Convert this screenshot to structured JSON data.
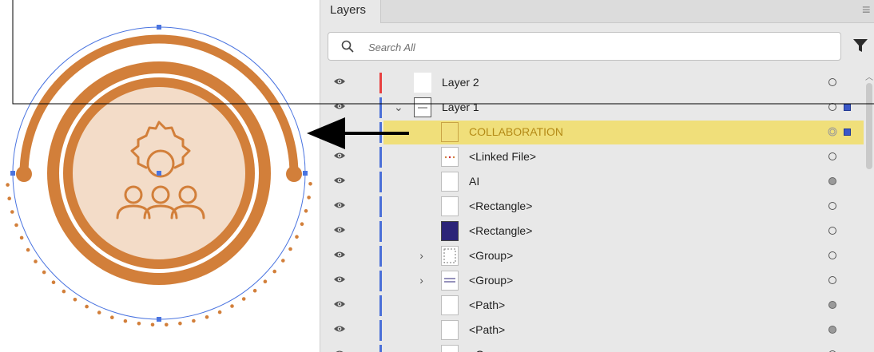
{
  "panel": {
    "tab_label": "Layers",
    "menu_icon": "hamburger-menu-icon",
    "search": {
      "placeholder": "Search All",
      "value": ""
    },
    "filter_icon": "filter-funnel-icon"
  },
  "layers": [
    {
      "label": "Layer 2",
      "bar_color": "#e84040",
      "thumb": "t-layer2",
      "chevron": "",
      "indent": 0,
      "target": "hollow",
      "selected": false,
      "selsq": false
    },
    {
      "label": "Layer 1",
      "bar_color": "#4a6fd8",
      "thumb": "t-layer1",
      "chevron": "⌄",
      "indent": 0,
      "target": "hollow",
      "selected": false,
      "selsq": true
    },
    {
      "label": "COLLABORATION",
      "bar_color": "#4a6fd8",
      "thumb": "t-collab",
      "chevron": "",
      "indent": 1,
      "target": "double",
      "selected": true,
      "selsq": true
    },
    {
      "label": "<Linked File>",
      "bar_color": "#4a6fd8",
      "thumb": "t-linked",
      "chevron": "",
      "indent": 1,
      "target": "hollow",
      "selected": false,
      "selsq": false
    },
    {
      "label": "AI",
      "bar_color": "#4a6fd8",
      "thumb": "t-blank",
      "chevron": "",
      "indent": 1,
      "target": "filled",
      "selected": false,
      "selsq": false
    },
    {
      "label": "<Rectangle>",
      "bar_color": "#4a6fd8",
      "thumb": "t-blank",
      "chevron": "",
      "indent": 1,
      "target": "hollow",
      "selected": false,
      "selsq": false
    },
    {
      "label": "<Rectangle>",
      "bar_color": "#4a6fd8",
      "thumb": "t-swatch",
      "chevron": "",
      "indent": 1,
      "target": "hollow",
      "selected": false,
      "selsq": false
    },
    {
      "label": "<Group>",
      "bar_color": "#4a6fd8",
      "thumb": "t-group1",
      "chevron": "›",
      "indent": 1,
      "target": "hollow",
      "selected": false,
      "selsq": false
    },
    {
      "label": "<Group>",
      "bar_color": "#4a6fd8",
      "thumb": "t-group2",
      "chevron": "›",
      "indent": 1,
      "target": "hollow",
      "selected": false,
      "selsq": false
    },
    {
      "label": "<Path>",
      "bar_color": "#4a6fd8",
      "thumb": "t-blank",
      "chevron": "",
      "indent": 1,
      "target": "filled",
      "selected": false,
      "selsq": false
    },
    {
      "label": "<Path>",
      "bar_color": "#4a6fd8",
      "thumb": "t-blank",
      "chevron": "",
      "indent": 1,
      "target": "filled",
      "selected": false,
      "selsq": false
    },
    {
      "label": "<Group>",
      "bar_color": "#4a6fd8",
      "thumb": "t-blank",
      "chevron": "›",
      "indent": 1,
      "target": "hollow",
      "selected": false,
      "selsq": false
    }
  ],
  "colors": {
    "artwork_orange": "#d27f3a",
    "artwork_fill": "#f3dcc8",
    "selection_highlight": "#f0df7a",
    "selection_blue": "#4a74e0"
  }
}
